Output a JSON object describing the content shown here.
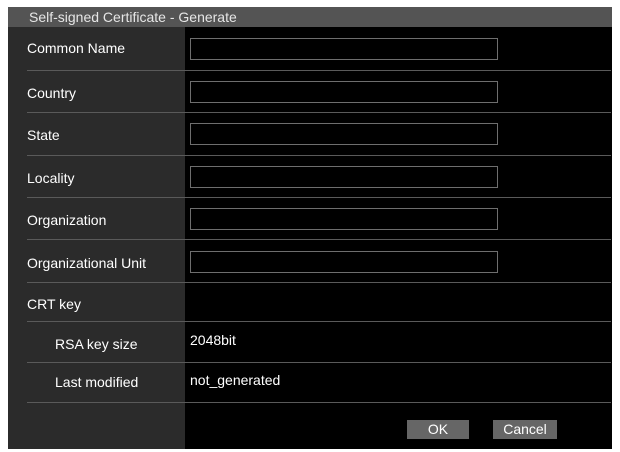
{
  "dialog": {
    "title": "Self-signed Certificate - Generate"
  },
  "fields": [
    {
      "label": "Common Name",
      "value": ""
    },
    {
      "label": "Country",
      "value": ""
    },
    {
      "label": "State",
      "value": ""
    },
    {
      "label": "Locality",
      "value": ""
    },
    {
      "label": "Organization",
      "value": ""
    },
    {
      "label": "Organizational Unit",
      "value": ""
    }
  ],
  "crt_key": {
    "label": "CRT key",
    "rsa_key_size_label": "RSA key size",
    "rsa_key_size_value": "2048bit",
    "last_modified_label": "Last modified",
    "last_modified_value": "not_generated"
  },
  "buttons": {
    "ok": "OK",
    "cancel": "Cancel"
  }
}
